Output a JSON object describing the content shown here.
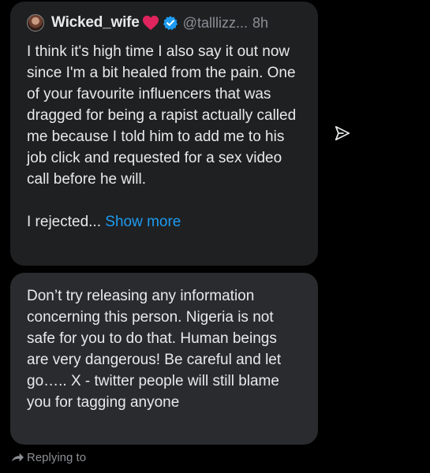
{
  "quoted_tweet": {
    "display_name": "Wicked_wife",
    "handle": "@talllizz...",
    "time": "8h",
    "body_paragraph_1": "I think it's high time I also say it out now since I'm a bit healed from the pain. One of your favourite influencers that was dragged for being a rapist actually called me because I told him to add me to his job click and requested for a sex video call before he will.",
    "body_paragraph_2": "I rejected...",
    "show_more_label": "Show more",
    "badge_icons": [
      "red-heart-icon",
      "verified-badge-icon"
    ]
  },
  "reply": {
    "text": "Don’t try releasing any information concerning this person. Nigeria is not safe for you to do that. Human beings are very dangerous! Be careful and let go….. X - twitter people will still blame you for tagging anyone"
  },
  "footer": {
    "replying_label": "Replying to",
    "icon": "reply-arrow-icon"
  },
  "side_actions": {
    "icon": "send-icon"
  },
  "colors": {
    "background": "#000000",
    "card": "#1f2022",
    "bubble": "#2a2b2e",
    "link": "#1d9bf0",
    "verified": "#1d9bf0",
    "heart": "#e0245e",
    "muted": "#8b8f94"
  }
}
